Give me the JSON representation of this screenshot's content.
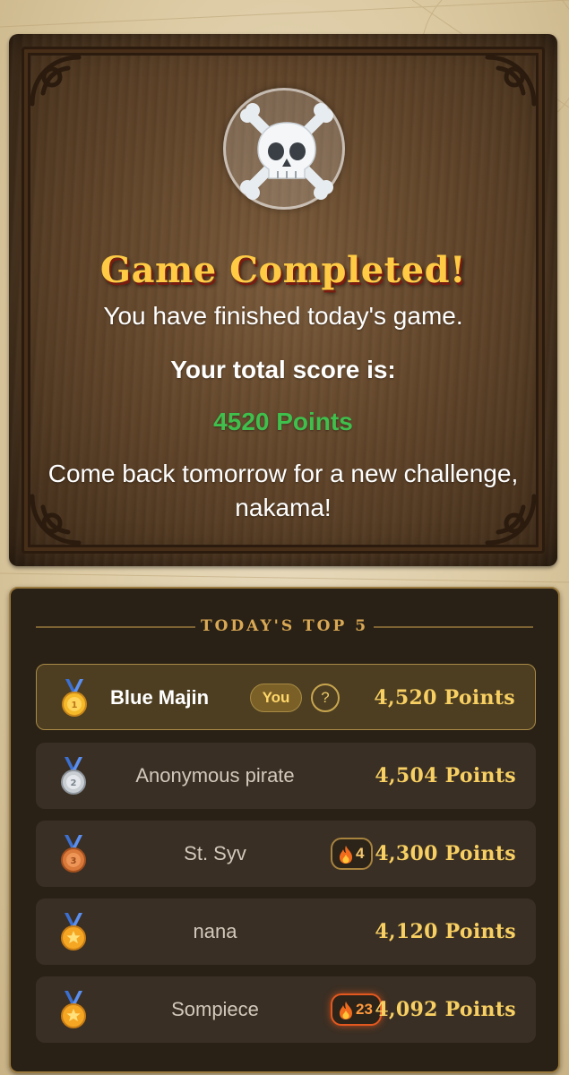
{
  "completion": {
    "icon": "skull-crossbones-icon",
    "title": "Game Completed!",
    "finished_text": "You have finished today's game.",
    "score_label": "Your total score is:",
    "points_text": "4520 Points",
    "comeback_text": "Come back tomorrow for a new challenge, nakama!"
  },
  "leaderboard": {
    "title": "TODAY'S TOP 5",
    "you_label": "You",
    "help_label": "?",
    "rows": [
      {
        "rank": 1,
        "medal": "gold-medal-icon",
        "name": "Blue Majin",
        "is_you": true,
        "streak": null,
        "score": "4,520 Points"
      },
      {
        "rank": 2,
        "medal": "silver-medal-icon",
        "name": "Anonymous pirate",
        "is_you": false,
        "streak": null,
        "score": "4,504 Points"
      },
      {
        "rank": 3,
        "medal": "bronze-medal-icon",
        "name": "St. Syv",
        "is_you": false,
        "streak": "4",
        "score": "4,300 Points"
      },
      {
        "rank": 4,
        "medal": "star-medal-icon",
        "name": "nana",
        "is_you": false,
        "streak": null,
        "score": "4,120 Points"
      },
      {
        "rank": 5,
        "medal": "star-medal-icon",
        "name": "Sompiece",
        "is_you": false,
        "streak": "23",
        "score": "4,092 Points"
      }
    ]
  },
  "colors": {
    "title_gold": "#ffcb45",
    "points_green": "#3fbf4c",
    "score_gold": "#f7cf62",
    "hot_streak": "#e3581e"
  }
}
